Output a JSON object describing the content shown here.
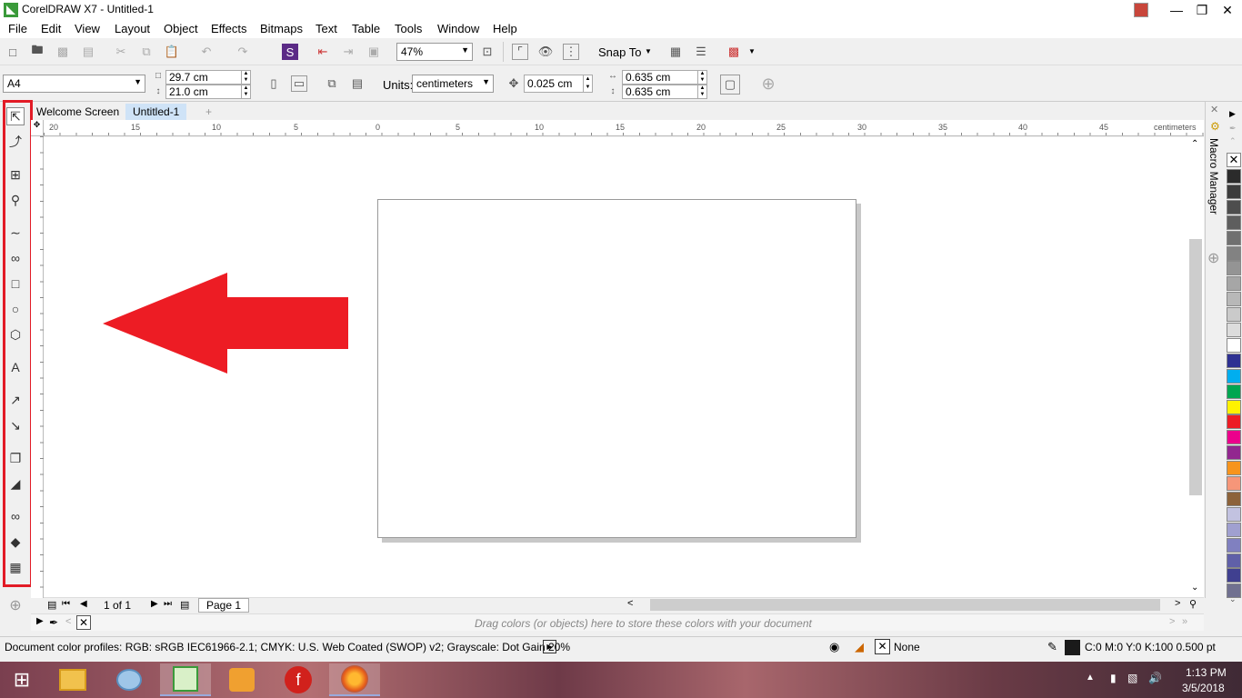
{
  "window": {
    "title": "CorelDRAW X7 - Untitled-1"
  },
  "menu": [
    "File",
    "Edit",
    "View",
    "Layout",
    "Object",
    "Effects",
    "Bitmaps",
    "Text",
    "Table",
    "Tools",
    "Window",
    "Help"
  ],
  "standard_toolbar": {
    "zoom": "47%",
    "snap_to": "Snap To"
  },
  "property_bar": {
    "page_size": "A4",
    "width": "29.7 cm",
    "height": "21.0 cm",
    "units_label": "Units:",
    "units": "centimeters",
    "nudge": "0.025 cm",
    "dup_x": "0.635 cm",
    "dup_y": "0.635 cm"
  },
  "tabs": [
    "Welcome Screen",
    "Untitled-1"
  ],
  "ruler": {
    "h_labels": [
      "20",
      "15",
      "10",
      "5",
      "0",
      "5",
      "10",
      "15",
      "20",
      "25",
      "30",
      "35",
      "40",
      "45"
    ],
    "unit": "centimeters"
  },
  "navigator": {
    "page_count": "1 of 1",
    "page_tab": "Page 1"
  },
  "docker": {
    "label": "Macro Manager"
  },
  "doc_palette": {
    "hint": "Drag colors (or objects) here to store these colors with your document"
  },
  "status": {
    "profiles": "Document color profiles: RGB: sRGB IEC61966-2.1; CMYK: U.S. Web Coated (SWOP) v2; Grayscale: Dot Gain 20%",
    "fill": "None",
    "outline": "C:0 M:0 Y:0 K:100  0.500 pt"
  },
  "taskbar": {
    "time": "1:13 PM",
    "date": "3/5/2018"
  },
  "colors": {
    "accent_red": "#e21b26",
    "palette": [
      "#2b2b2b",
      "#3c3c3c",
      "#4d4d4d",
      "#5e5e5e",
      "#707070",
      "#828282",
      "#949494",
      "#a6a6a6",
      "#b8b8b8",
      "#cacaca",
      "#dcdcdc",
      "#ffffff",
      "#2e3192",
      "#00aeef",
      "#00a651",
      "#fff200",
      "#ed1c24",
      "#ec008c",
      "#92278f",
      "#f7941d",
      "#f69679",
      "#8c6239",
      "#c2c2e0",
      "#a0a0d0",
      "#8080c0",
      "#6060a8",
      "#404090",
      "#707090"
    ]
  }
}
